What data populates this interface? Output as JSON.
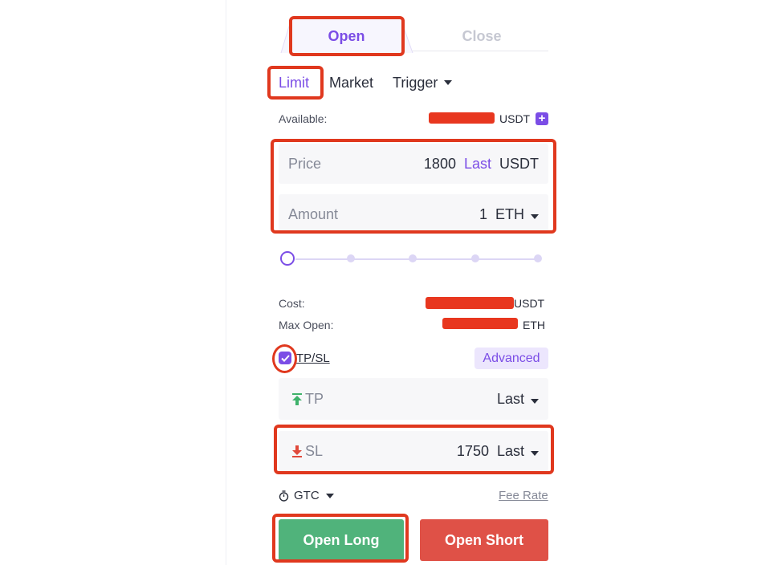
{
  "tabs": {
    "open": "Open",
    "close": "Close"
  },
  "order_types": {
    "limit": "Limit",
    "market": "Market",
    "trigger": "Trigger"
  },
  "available": {
    "label": "Available:",
    "unit": "USDT"
  },
  "price": {
    "label": "Price",
    "value": "1800",
    "last": "Last",
    "unit": "USDT"
  },
  "amount": {
    "label": "Amount",
    "value": "1",
    "unit": "ETH"
  },
  "slider": {
    "level": 0
  },
  "cost": {
    "label": "Cost:",
    "unit": "USDT"
  },
  "max_open": {
    "label": "Max Open:",
    "unit": "ETH"
  },
  "tpsl": {
    "label": "TP/SL",
    "checked": true,
    "advanced": "Advanced"
  },
  "tp": {
    "label": "TP",
    "value": "",
    "mode": "Last"
  },
  "sl": {
    "label": "SL",
    "value": "1750",
    "mode": "Last"
  },
  "tif": {
    "value": "GTC"
  },
  "fee_rate": "Fee Rate",
  "buttons": {
    "open_long": "Open Long",
    "open_short": "Open Short"
  },
  "colors": {
    "accent": "#7b4de6",
    "long": "#50b37b",
    "short": "#df5147",
    "annotation": "#e0381e"
  }
}
